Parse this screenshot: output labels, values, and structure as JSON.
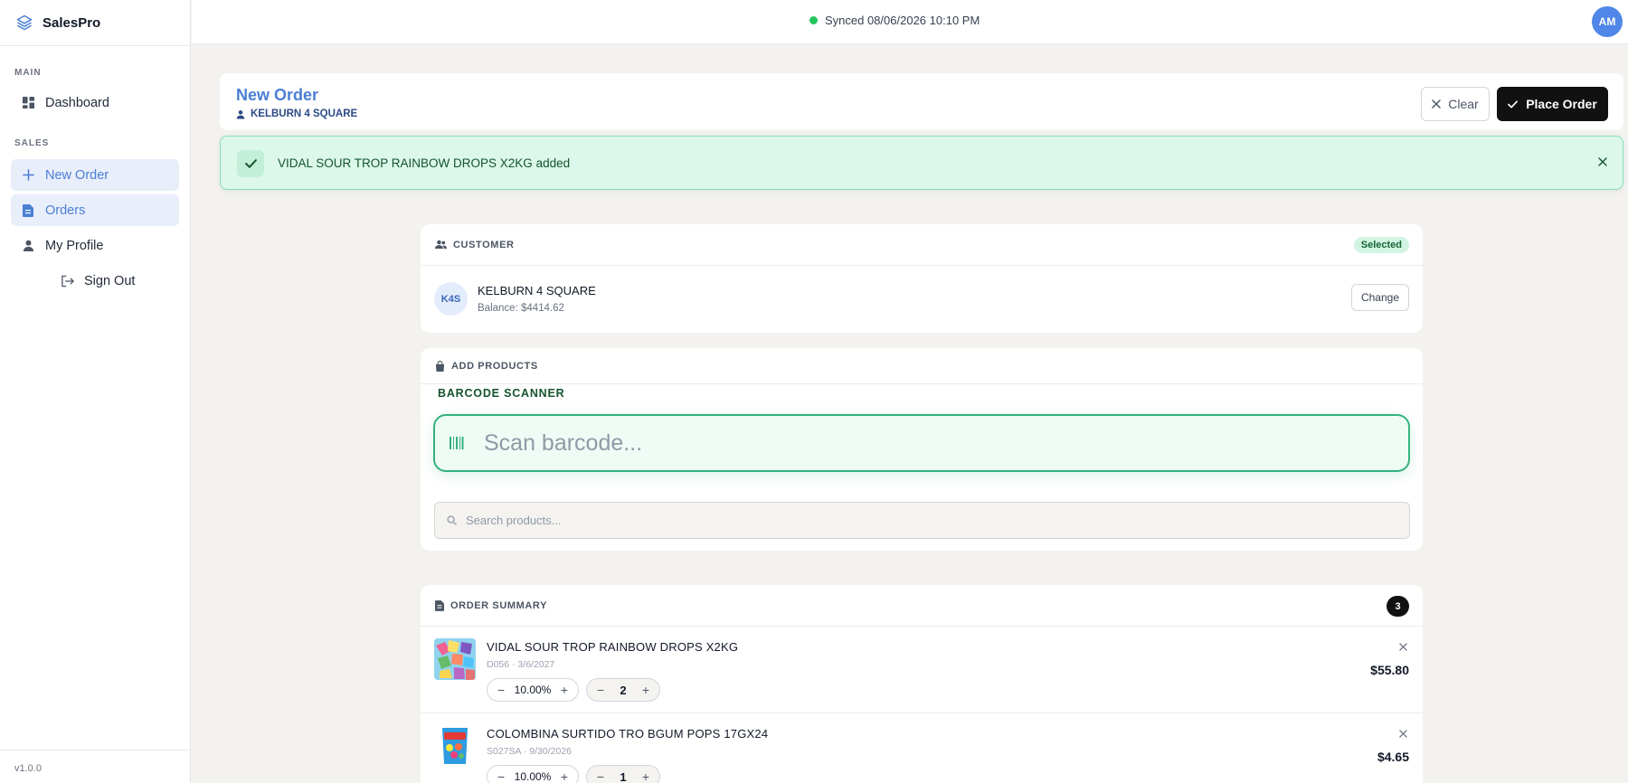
{
  "app": {
    "name": "SalesPro",
    "version": "v1.0.0"
  },
  "sidebar": {
    "main_label": "MAIN",
    "sales_label": "SALES",
    "items": [
      {
        "label": "Dashboard",
        "icon": "dashboard-icon"
      },
      {
        "label": "New Order",
        "icon": "plus-icon",
        "active": true
      },
      {
        "label": "Orders",
        "icon": "document-icon",
        "active": true
      },
      {
        "label": "My Profile",
        "icon": "user-icon"
      },
      {
        "label": "Sign Out",
        "icon": "sign-out-icon"
      }
    ]
  },
  "topbar": {
    "sync_text": "Synced 08/06/2026 10:10 PM",
    "sync_color": "#22c55e",
    "avatar_initials": "AM"
  },
  "header": {
    "title": "New Order",
    "customer": "KELBURN 4 SQUARE",
    "clear_label": "Clear",
    "place_label": "Place Order"
  },
  "toast": {
    "message": "VIDAL SOUR TROP RAINBOW DROPS X2KG added"
  },
  "customer_card": {
    "heading": "CUSTOMER",
    "badge": "Selected",
    "initials": "K4S",
    "name": "KELBURN 4 SQUARE",
    "balance": "Balance: $4414.62",
    "change_label": "Change"
  },
  "products_card": {
    "heading": "ADD PRODUCTS",
    "scanner_label": "BARCODE SCANNER",
    "scan_placeholder": "Scan barcode...",
    "search_placeholder": "Search products..."
  },
  "summary_card": {
    "heading": "ORDER SUMMARY",
    "count": "3",
    "items": [
      {
        "name": "VIDAL SOUR TROP RAINBOW DROPS X2KG",
        "meta": "D056 · 3/6/2027",
        "discount": "10.00%",
        "qty": "2",
        "price": "$55.80"
      },
      {
        "name": "COLOMBINA SURTIDO TRO BGUM POPS 17GX24",
        "meta": "S027SA · 9/30/2026",
        "discount": "10.00%",
        "qty": "1",
        "price": "$4.65"
      }
    ]
  },
  "colors": {
    "accent": "#4a7fd4",
    "success": "#34b27f",
    "primary_button": "#111111"
  }
}
